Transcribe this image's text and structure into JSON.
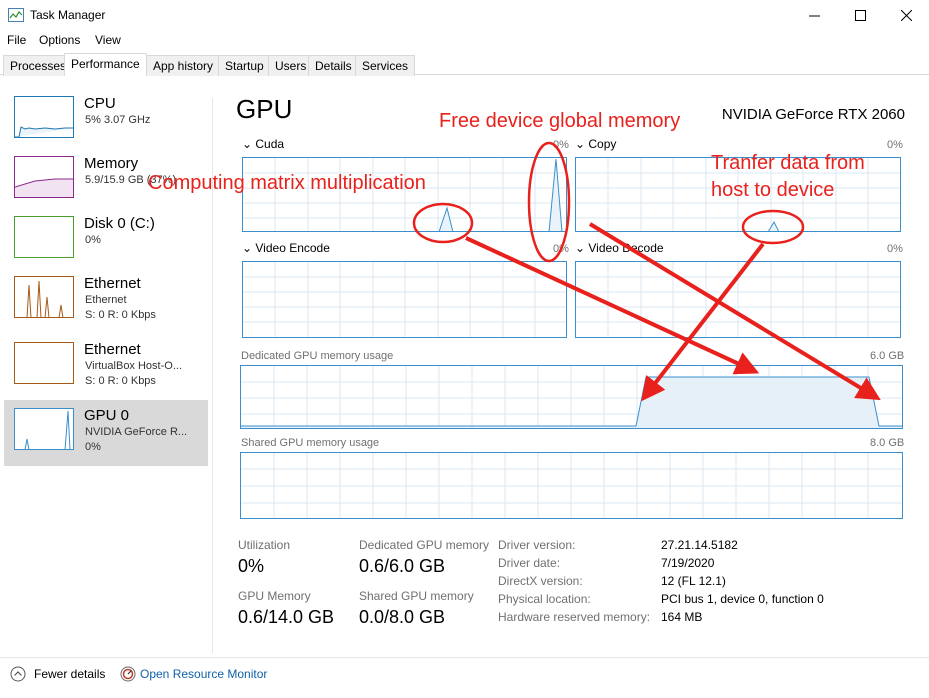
{
  "window": {
    "title": "Task Manager"
  },
  "menu": [
    "File",
    "Options",
    "View"
  ],
  "tabs": [
    "Processes",
    "Performance",
    "App history",
    "Startup",
    "Users",
    "Details",
    "Services"
  ],
  "sidebar": {
    "items": [
      {
        "name": "CPU",
        "sub1": "5% 3.07 GHz",
        "sub2": ""
      },
      {
        "name": "Memory",
        "sub1": "5.9/15.9 GB (37%)",
        "sub2": ""
      },
      {
        "name": "Disk 0 (C:)",
        "sub1": "0%",
        "sub2": ""
      },
      {
        "name": "Ethernet",
        "sub1": "Ethernet",
        "sub2": "S: 0 R: 0 Kbps"
      },
      {
        "name": "Ethernet",
        "sub1": "VirtualBox Host-O...",
        "sub2": "S: 0 R: 0 Kbps"
      },
      {
        "name": "GPU 0",
        "sub1": "NVIDIA GeForce R...",
        "sub2": "0%"
      }
    ]
  },
  "main": {
    "title": "GPU",
    "model": "NVIDIA GeForce RTX 2060",
    "engines": [
      {
        "label": "Cuda",
        "pct": "0%"
      },
      {
        "label": "Copy",
        "pct": "0%"
      },
      {
        "label": "Video Encode",
        "pct": "0%"
      },
      {
        "label": "Video Decode",
        "pct": "0%"
      }
    ],
    "dedicated": {
      "label": "Dedicated GPU memory usage",
      "max": "6.0 GB"
    },
    "shared": {
      "label": "Shared GPU memory usage",
      "max": "8.0 GB"
    },
    "stats": {
      "utilization_label": "Utilization",
      "utilization": "0%",
      "dedicated_label": "Dedicated GPU memory",
      "dedicated": "0.6/6.0 GB",
      "gpu_memory_label": "GPU Memory",
      "gpu_memory": "0.6/14.0 GB",
      "shared_label": "Shared GPU memory",
      "shared": "0.0/8.0 GB"
    },
    "info": [
      {
        "key": "Driver version:",
        "value": "27.21.14.5182"
      },
      {
        "key": "Driver date:",
        "value": "7/19/2020"
      },
      {
        "key": "DirectX version:",
        "value": "12 (FL 12.1)"
      },
      {
        "key": "Physical location:",
        "value": "PCI bus 1, device 0, function 0"
      },
      {
        "key": "Hardware reserved memory:",
        "value": "164 MB"
      }
    ]
  },
  "footer": {
    "fewer_details": "Fewer details",
    "open_monitor": "Open Resource Monitor"
  },
  "annotations": {
    "free_memory": "Free device global memory",
    "matrix": "Computing matrix multiplication",
    "transfer_line1": "Tranfer data from",
    "transfer_line2": "host to device"
  },
  "colors": {
    "gpu_line": "#3a8fcc",
    "cpu_line": "#1e78b4",
    "memory_line": "#8b2a8b",
    "disk_line": "#4aa02c",
    "ethernet_line": "#a75a16",
    "annotation": "#e8211c",
    "selected_bg": "#d9d9d9",
    "link": "#1060a8"
  }
}
